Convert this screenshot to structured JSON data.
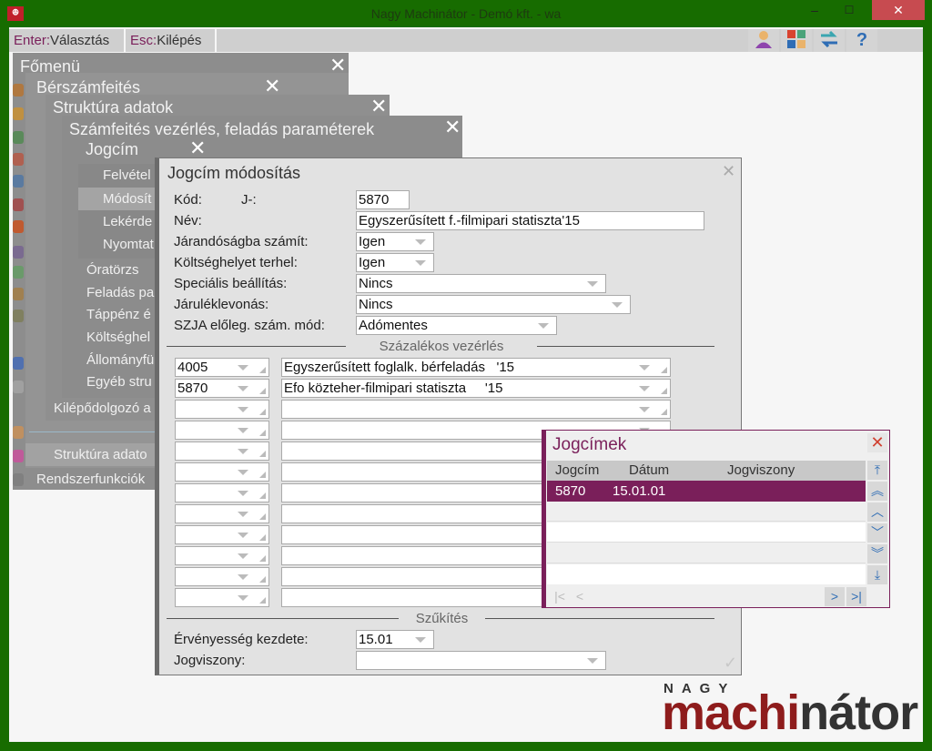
{
  "window": {
    "title": "Nagy Machinátor - Demó kft. - wa",
    "minimize": "–",
    "maximize": "☐",
    "close": "✕"
  },
  "toolbar": {
    "enter_key": "Enter:",
    "enter_label": "Választás",
    "esc_key": "Esc:",
    "esc_label": "Kilépés"
  },
  "menus": {
    "main": "Főmenü",
    "payroll": "Bérszámfeités",
    "structure": "Struktúra adatok",
    "params": "Számfeités vezérlés, feladás paraméterek",
    "jogcim": "Jogcím",
    "jogcim_items": [
      "Felvétel",
      "Módosít",
      "Lekérde",
      "Nyomtat"
    ],
    "param_items": [
      "Óratörzs",
      "Feladás pa",
      "Táppénz é",
      "Költséghel",
      "Állományfü",
      "Egyéb stru"
    ],
    "exit_item": "Kilépődolgozó a",
    "structure_item": "Struktúra adato",
    "system_item": "Rendszerfunkciók"
  },
  "dialog": {
    "title": "Jogcím módosítás",
    "kod_label": "Kód:",
    "kod_prefix": "J-:",
    "kod_value": "5870",
    "nev_label": "Név:",
    "nev_value": "Egyszerűsített f.-filmipari statiszta'15",
    "jarandosag_label": "Járandóságba számít:",
    "jarandosag_value": "Igen",
    "koltseghely_label": "Költséghelyet terhel:",
    "koltseghely_value": "Igen",
    "specialis_label": "Speciális beállítás:",
    "specialis_value": "Nincs",
    "jarulek_label": "Járuléklevonás:",
    "jarulek_value": "Nincs",
    "szja_label": "SZJA előleg. szám. mód:",
    "szja_value": "Adómentes",
    "section_percent": "Százalékos vezérlés",
    "rows": [
      {
        "code": "4005",
        "name": "Egyszerűsített foglalk. bérfeladás   '15"
      },
      {
        "code": "5870",
        "name": "Efo közteher-filmipari statiszta     '15"
      },
      {
        "code": "",
        "name": ""
      },
      {
        "code": "",
        "name": ""
      },
      {
        "code": "",
        "name": ""
      },
      {
        "code": "",
        "name": ""
      },
      {
        "code": "",
        "name": ""
      },
      {
        "code": "",
        "name": ""
      },
      {
        "code": "",
        "name": ""
      },
      {
        "code": "",
        "name": ""
      },
      {
        "code": "",
        "name": ""
      },
      {
        "code": "",
        "name": ""
      }
    ],
    "section_filter": "Szűkítés",
    "ervenyesseg_label": "Érvényesség kezdete:",
    "ervenyesseg_value": "15.01",
    "jogviszony_label": "Jogviszony:",
    "jogviszony_value": "",
    "ok": "✓",
    "close": "✕"
  },
  "popup": {
    "title": "Jogcímek",
    "close": "✕",
    "columns": [
      "Jogcím",
      "Dátum",
      "Jogviszony"
    ],
    "rows": [
      {
        "jogcim": "5870",
        "datum": "15.01.01",
        "jogviszony": ""
      }
    ],
    "accent": "#7a1f5a"
  },
  "logo": {
    "top": "NAGY",
    "red": "machi",
    "dark": "nátor"
  }
}
